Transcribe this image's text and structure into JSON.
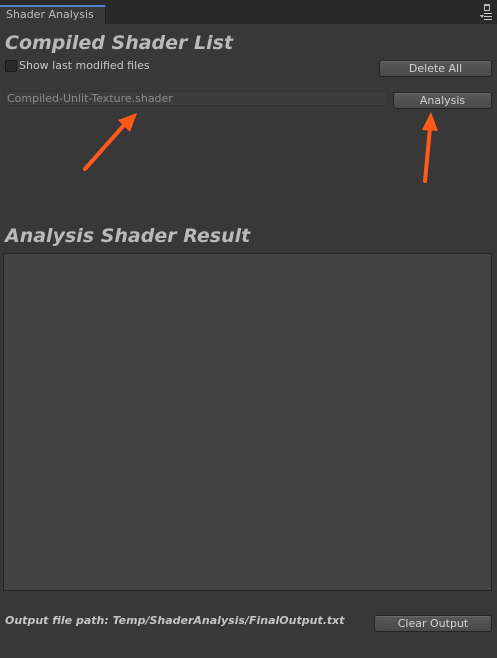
{
  "window": {
    "tab_title": "Shader Analysis"
  },
  "compiled_section": {
    "heading": "Compiled Shader List",
    "show_modified_label": "Show last modified files",
    "show_modified_checked": false,
    "delete_all_label": "Delete All",
    "shaders": [
      {
        "name": "Compiled-Unlit-Texture.shader",
        "analysis_label": "Analysis"
      }
    ]
  },
  "result_section": {
    "heading": "Analysis Shader Result",
    "output_text": ""
  },
  "footer": {
    "output_path": "Output file path: Temp/ShaderAnalysis/FinalOutput.txt",
    "clear_output_label": "Clear Output"
  },
  "annotations": {
    "arrow_color": "#ff5a1a"
  }
}
